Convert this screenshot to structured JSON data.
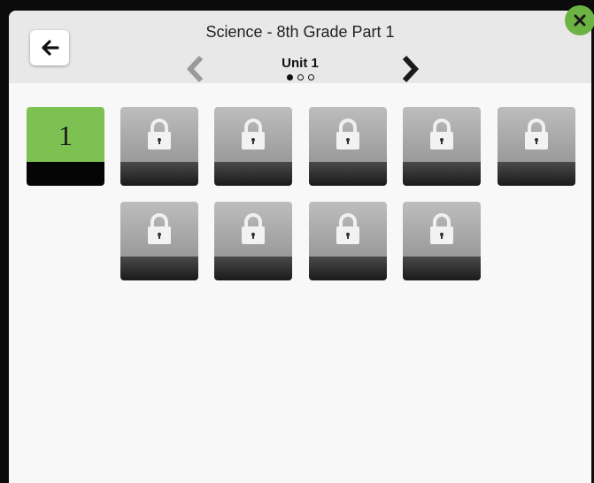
{
  "header": {
    "title": "Science - 8th Grade Part 1",
    "unit_label": "Unit 1",
    "page_count": 3,
    "current_page": 1
  },
  "tiles": [
    {
      "label": "1",
      "state": "unlocked"
    },
    {
      "label": "",
      "state": "locked",
      "icon": "lock-icon"
    },
    {
      "label": "",
      "state": "locked",
      "icon": "lock-icon"
    },
    {
      "label": "",
      "state": "locked",
      "icon": "lock-icon"
    },
    {
      "label": "",
      "state": "locked",
      "icon": "lock-icon"
    },
    {
      "label": "",
      "state": "locked",
      "icon": "lock-icon"
    },
    {
      "label": "",
      "state": "locked",
      "icon": "lock-icon"
    },
    {
      "label": "",
      "state": "locked",
      "icon": "lock-icon"
    },
    {
      "label": "",
      "state": "locked",
      "icon": "lock-icon"
    },
    {
      "label": "",
      "state": "locked",
      "icon": "lock-icon"
    }
  ],
  "icons": {
    "back": "arrow-left-icon",
    "prev": "chevron-left-icon",
    "next": "chevron-right-icon",
    "close": "close-icon"
  },
  "colors": {
    "unlocked_tile": "#7cc152",
    "close_button": "#6db344",
    "header_bg": "#e8e8e8",
    "body_bg": "#f8f8f8"
  }
}
